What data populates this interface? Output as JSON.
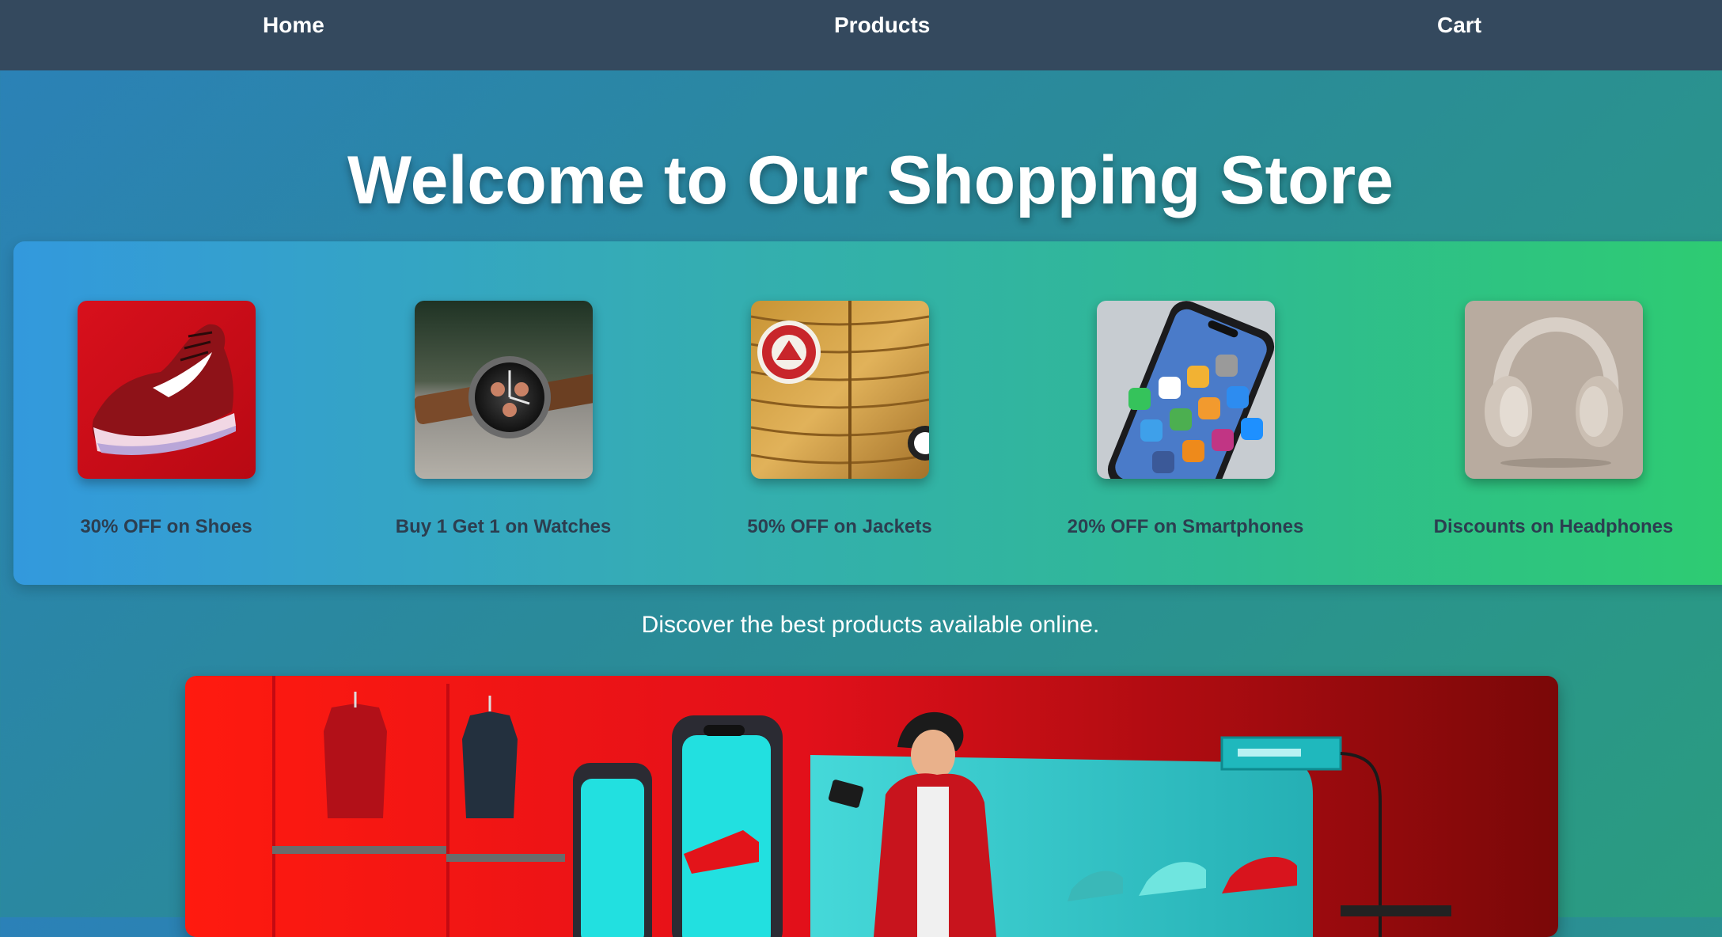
{
  "nav": {
    "home": "Home",
    "products": "Products",
    "cart": "Cart"
  },
  "hero": {
    "title": "Welcome to Our Shopping Store"
  },
  "offers": [
    {
      "label": "30% OFF on Shoes",
      "icon": "shoe-image"
    },
    {
      "label": "Buy 1 Get 1 on Watches",
      "icon": "watch-image"
    },
    {
      "label": "50% OFF on Jackets",
      "icon": "jacket-image"
    },
    {
      "label": "20% OFF on Smartphones",
      "icon": "smartphone-image"
    },
    {
      "label": "Discounts on Headphones",
      "icon": "headphones-image"
    }
  ],
  "tagline": "Discover the best products available online.",
  "colors": {
    "nav_bg": "#34495e",
    "offer_text": "#2c3e50",
    "panel_start": "#3399dd",
    "panel_end": "#2ecc71"
  }
}
